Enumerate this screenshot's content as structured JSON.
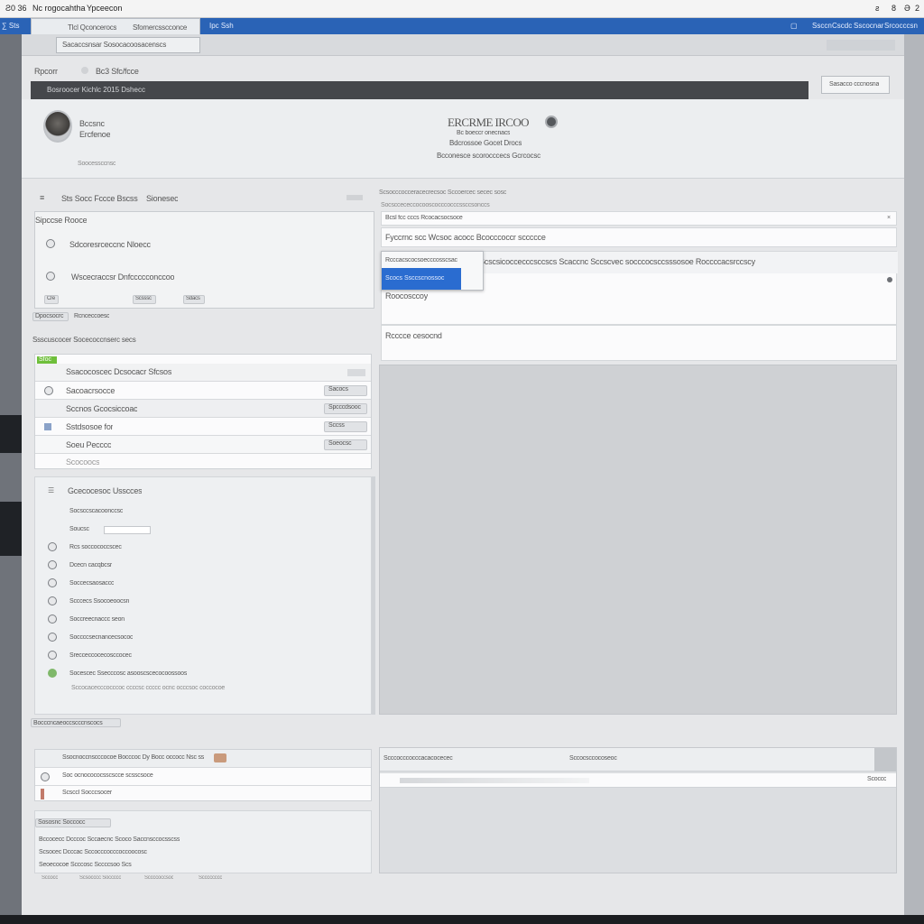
{
  "os_bar": {
    "left_text_1": "Ƨ0 36",
    "left_text_2": "Nc rogocahtha",
    "left_text_3": "Ypceecon",
    "right_icons": [
      "ƨ",
      "8",
      "Ә",
      "2a"
    ]
  },
  "browser_bar": {
    "left_label": "∑ Sts",
    "tab_label": "Tlcl Qconcerocs",
    "tab_label_2": "Sfomercsscconce",
    "nav_label": "Ipc  Ssh",
    "right_labels": [
      "Ssccn",
      "Cscdc",
      "Sscocnar",
      "Srcocccsn"
    ]
  },
  "toolbar": {
    "subtab_label": "Sacaccsnsar  Sosocacoosacenscs"
  },
  "header": {
    "label_left": "Rpcorr",
    "label_right": "Bc3 Sfc/fcce",
    "dark_bar_text": "Bosroocer Kichlc 2015 Dshecc",
    "right_button": "Sasacco cccnosna"
  },
  "profile": {
    "name_line_1": "Bccsnc",
    "name_line_2": "Ercfenoe",
    "caption": "Soocessccnsc",
    "center_title": "ERCRME IRCOO",
    "center_sub_1": "Bc boeccr onecnacs",
    "center_sub_2": "Bdcrossoe Gocet Drocs",
    "center_sub_3": "Bcconesce scorocccecs Gcrcocsc"
  },
  "left_panel": {
    "section_title": "Sts Socc Fccce Bscss",
    "section_aux": "Sionesec",
    "group_label": "Sipccse Rooce",
    "item_1": "Sdcoresrceccnc Nloecc",
    "item_2": "Wscecraccsr Dnfccccconccoo",
    "buttons": [
      "Cre",
      "Scsssc",
      "Sdacs"
    ],
    "tag_label": "Dpocsocrc",
    "tag_desc": "Rcnceccoesc",
    "line_text": "Ssscuscocer Socecoccnserc secs",
    "green_badge": "Sfoc"
  },
  "list_rows": [
    {
      "label": "Ssacocoscec Dcsocacr Sfcsos",
      "value": ""
    },
    {
      "label": "Sacoacrsocce",
      "value": "Sacocs"
    },
    {
      "label": "Sccnos Gcocsiccoac",
      "value": "Spcccdsooc"
    },
    {
      "label": "Sstdsosoe for",
      "value": "Sccss"
    },
    {
      "label": "Soeu Pecccc",
      "value": "Soeocsc"
    },
    {
      "label": "Scocoocs",
      "value": ""
    }
  ],
  "tree": {
    "heading": "Gcecocesoc Usscces",
    "items": [
      "Socsccscacoonccsc",
      "Soucsc",
      "Rcs soccococcscec",
      "Dcecn cacqbcsr",
      "Soccecsaosaccc",
      "Scccecs Ssocoeoocsn",
      "Soccreecnaccc seon",
      "Soccccsecnancecsococ",
      "Srecceccocecosccocec",
      "Socescec Ssecccosc asooscscecocoossoos"
    ],
    "footer": "Sccocacecccocccoc ccccsc ccccc ocnc occcsoc coccocoe"
  },
  "right_panel": {
    "heading": "Scsocccocceracecrecsoc Sccoercec secec sosc",
    "subheading": "Socsccececcocooscocccocccssccsonccs",
    "bar_text": "Bcsl fcc cccs  Rcocacsocsoce",
    "field_1": "Fyccrnc scc  Wcsoc acocc  Bcocccoccr sccccce",
    "dropdown_item_top": "Rcccacscocsoecccosscsac",
    "dropdown_item_selected": "Scocs Ssccscnossoc",
    "field_2": "Scscsicoccecccsccscs Scaccnc Sccscvec socccocsccsssosoe Roccccacsrccscy",
    "field_3": "Roocosccoy",
    "field_4": "Rcccce cesocnd"
  },
  "bottom_left": {
    "title": "Bocccncaeoccscccnscocs",
    "rows": [
      "Ssocnoccnscccocoe  Bocccoc  Dy Bocc occocc Nsc ss",
      "Soc ocnocococsscscce scsscsoce",
      "Scsccl Socccsocer"
    ],
    "section_2": "Sososnc Soccocc",
    "lines": [
      "Bccocecc Dcccoc Sccaecnc Scoco Saccnsccocsscss",
      "Scsocec Dcccac Sccocccocccoccoocosc",
      "Seoecocoe Scccosc Sccccsoo Scs"
    ],
    "footer": [
      "Sccocc",
      "Scsocccc Socccco",
      "Sccccoccsoc",
      "Scccccccc"
    ]
  },
  "bottom_right": {
    "row_text": "Scccocccocccacacocecec",
    "row_text_2": "Sccocsccocoseoc",
    "row_text_3": "Scoccc"
  },
  "colors": {
    "accent_blue": "#2a6cd0",
    "browser_blue": "#2a63b6",
    "dark_bar": "#45474b",
    "green_badge": "#6fbf3b"
  }
}
